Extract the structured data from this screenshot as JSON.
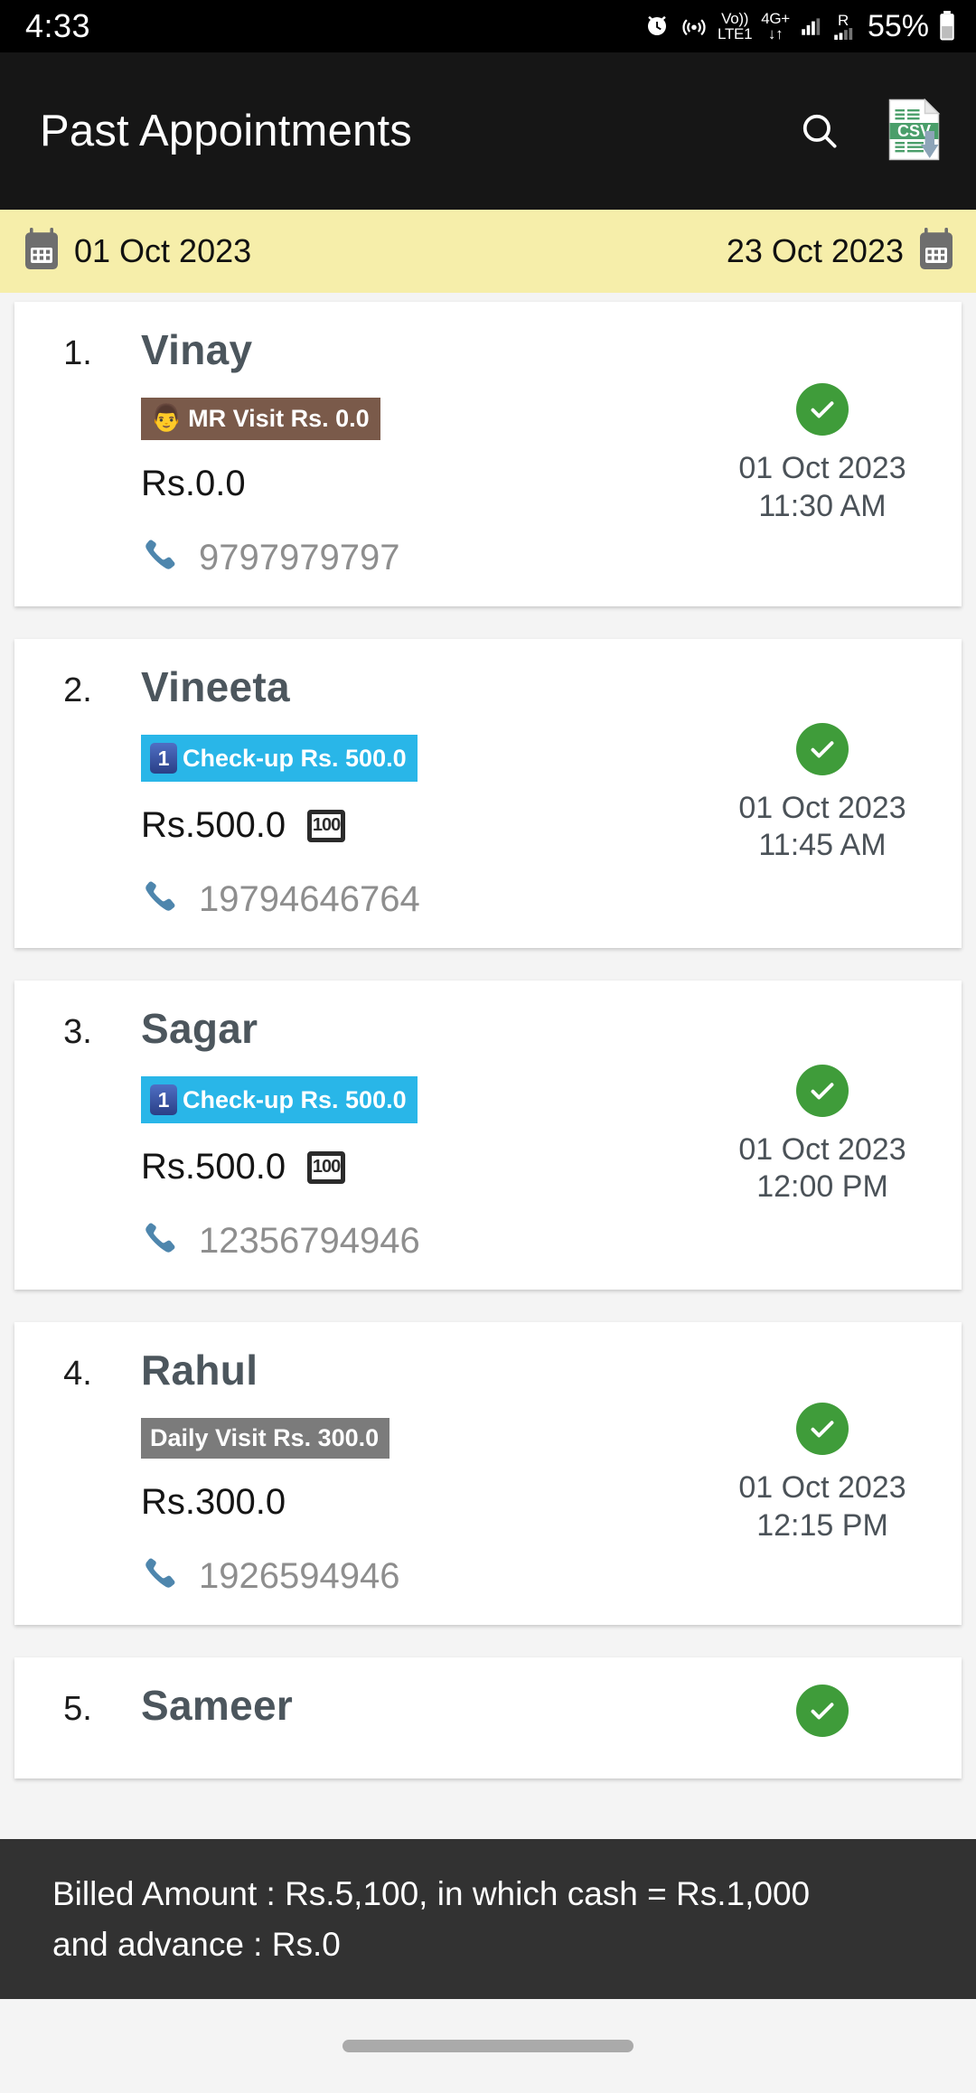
{
  "status_bar": {
    "time": "4:33",
    "battery": "55%",
    "network_label_top": "Vo))",
    "network_label_bottom": "LTE1",
    "data_label": "4G+",
    "roaming_label": "R",
    "icons": [
      "alarm-icon",
      "hotspot-icon",
      "volte-icon",
      "data-4gplus-icon",
      "signal-bars-icon",
      "roaming-signal-icon",
      "battery-icon"
    ]
  },
  "app_bar": {
    "title": "Past Appointments",
    "search_icon": "search-icon",
    "export_icon": "csv-download-icon",
    "export_label": "CSV"
  },
  "date_bar": {
    "start_date": "01 Oct 2023",
    "end_date": "23 Oct 2023",
    "calendar_icon": "calendar-icon",
    "background_color": "#f6eeaa"
  },
  "appointments": [
    {
      "index": "1.",
      "name": "Vinay",
      "badge_emoji": "👨",
      "badge_label": "MR Visit Rs. 0.0",
      "badge_color": "#7a5a4a",
      "amount": "Rs.0.0",
      "has_cash_icon": false,
      "phone": "9797979797",
      "status_icon": "check-circle-icon",
      "date": "01 Oct 2023",
      "time": "11:30 AM"
    },
    {
      "index": "2.",
      "name": "Vineeta",
      "badge_emoji": "1",
      "badge_label": "Check-up Rs. 500.0",
      "badge_color": "#29b6e8",
      "amount": "Rs.500.0",
      "has_cash_icon": true,
      "cash_icon_label": "100",
      "phone": "19794646764",
      "status_icon": "check-circle-icon",
      "date": "01 Oct 2023",
      "time": "11:45 AM"
    },
    {
      "index": "3.",
      "name": "Sagar",
      "badge_emoji": "1",
      "badge_label": "Check-up Rs. 500.0",
      "badge_color": "#29b6e8",
      "amount": "Rs.500.0",
      "has_cash_icon": true,
      "cash_icon_label": "100",
      "phone": "12356794946",
      "status_icon": "check-circle-icon",
      "date": "01 Oct 2023",
      "time": "12:00 PM"
    },
    {
      "index": "4.",
      "name": "Rahul",
      "badge_emoji": "",
      "badge_label": "Daily Visit Rs. 300.0",
      "badge_color": "#7b7b7b",
      "amount": "Rs.300.0",
      "has_cash_icon": false,
      "phone": "1926594946",
      "status_icon": "check-circle-icon",
      "date": "01 Oct 2023",
      "time": "12:15 PM"
    },
    {
      "index": "5.",
      "name": "Sameer",
      "badge_emoji": "",
      "badge_label": "",
      "badge_color": "",
      "amount": "",
      "has_cash_icon": false,
      "phone": "",
      "status_icon": "check-circle-icon",
      "date": "",
      "time": ""
    }
  ],
  "snackbar": {
    "line1": "Billed Amount : Rs.5,100, in which cash = Rs.1,000",
    "line2": "and advance : Rs.0",
    "background_color": "#323232"
  },
  "nav_bar": {
    "gesture_pill": "home-gesture-pill"
  }
}
